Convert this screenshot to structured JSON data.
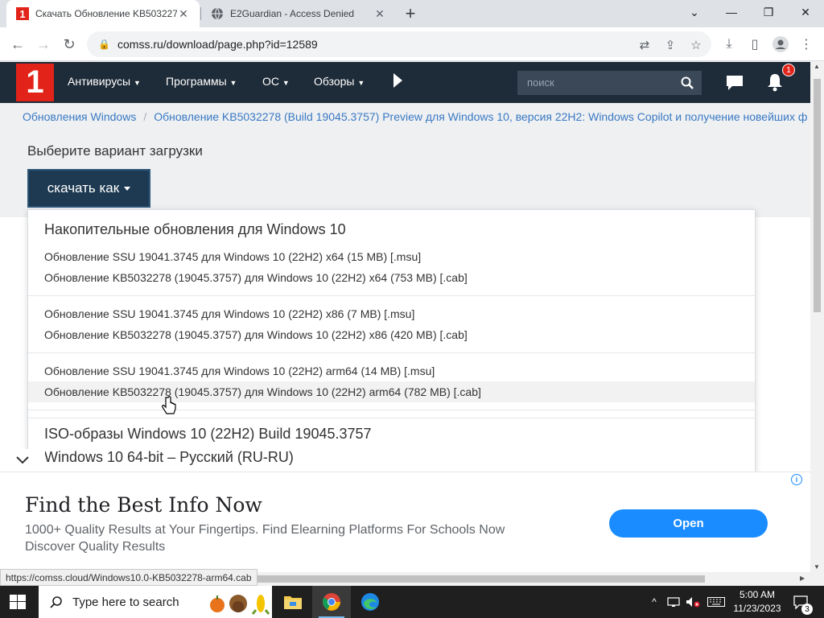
{
  "browser": {
    "tabs": [
      {
        "title": "Скачать Обновление KB5032278",
        "active": true
      },
      {
        "title": "E2Guardian - Access Denied",
        "active": false
      }
    ],
    "url": "comss.ru/download/page.php?id=12589"
  },
  "site": {
    "logo_text": "1",
    "nav": [
      "Антивирусы",
      "Программы",
      "ОС",
      "Обзоры"
    ],
    "search_placeholder": "поиск",
    "notification_count": "1"
  },
  "breadcrumb": [
    "Обновления Windows",
    "Обновление KB5032278 (Build 19045.3757) Preview для Windows 10, версия 22H2: Windows Copilot и получение новейших ф"
  ],
  "content": {
    "choose_label": "Выберите вариант загрузки",
    "download_button": "скачать как"
  },
  "dropdown": {
    "section1_title": "Накопительные обновления для Windows 10",
    "group1": [
      "Обновление SSU 19041.3745 для Windows 10 (22H2) x64 (15 MB) [.msu]",
      "Обновление KB5032278 (19045.3757) для Windows 10 (22H2) x64 (753 MB) [.cab]"
    ],
    "group2": [
      "Обновление SSU 19041.3745 для Windows 10 (22H2) x86 (7 MB) [.msu]",
      "Обновление KB5032278 (19045.3757) для Windows 10 (22H2) x86 (420 MB) [.cab]"
    ],
    "group3": [
      "Обновление SSU 19041.3745 для Windows 10 (22H2) arm64 (14 MB) [.msu]",
      "Обновление KB5032278 (19045.3757) для Windows 10 (22H2) arm64 (782 MB) [.cab]"
    ],
    "section2_title": "ISO-образы Windows 10 (22H2) Build 19045.3757",
    "section2_sub": "Windows 10 64-bit – Русский (RU-RU)"
  },
  "ad": {
    "title": "Find the Best Info Now",
    "line1": "1000+ Quality Results at Your Fingertips. Find Elearning Platforms For Schools Now",
    "line2": "Discover Quality Results",
    "button": "Open",
    "info": "i"
  },
  "status_url": "https://comss.cloud/Windows10.0-KB5032278-arm64.cab",
  "taskbar": {
    "search_placeholder": "Type here to search",
    "time": "5:00 AM",
    "date": "11/23/2023",
    "notification_count": "3"
  },
  "colors": {
    "site_header": "#1e2b38",
    "brand_red": "#e2231a",
    "link_blue": "#3a79c3",
    "ad_button": "#1a8cff"
  }
}
